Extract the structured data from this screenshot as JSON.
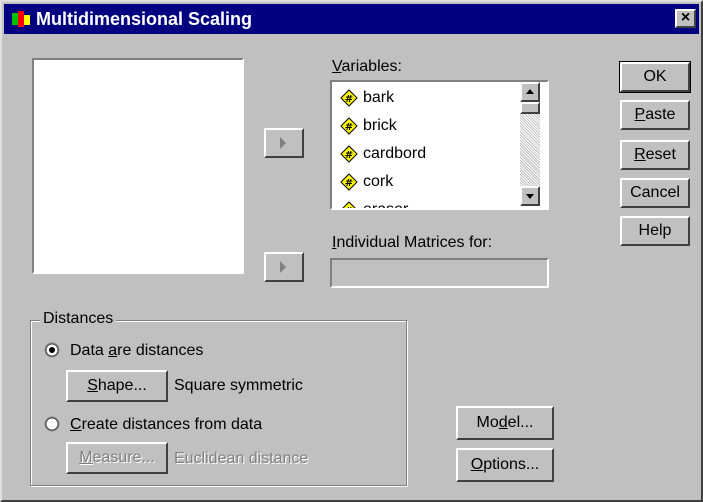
{
  "window": {
    "title": "Multidimensional Scaling",
    "close_label": "×"
  },
  "variables": {
    "label": "Variables:",
    "items": [
      {
        "name": "bark",
        "icon": "numeric-variable-icon"
      },
      {
        "name": "brick",
        "icon": "numeric-variable-icon"
      },
      {
        "name": "cardbord",
        "icon": "numeric-variable-icon"
      },
      {
        "name": "cork",
        "icon": "numeric-variable-icon"
      },
      {
        "name": "eraser",
        "icon": "numeric-variable-icon"
      }
    ]
  },
  "individual_matrices": {
    "label": "Individual Matrices for:",
    "value": ""
  },
  "distances": {
    "group_label": "Distances",
    "option_data_are": "Data are distances",
    "option_data_are_selected": true,
    "shape_button": "Shape...",
    "shape_value": "Square symmetric",
    "option_create": "Create distances from data",
    "option_create_selected": false,
    "measure_button": "Measure...",
    "measure_value": "Euclidean distance"
  },
  "buttons": {
    "ok": "OK",
    "paste": "Paste",
    "reset": "Reset",
    "cancel": "Cancel",
    "help": "Help",
    "model": "Model...",
    "options": "Options..."
  },
  "colors": {
    "title_bar": "#000080",
    "dialog_bg": "#c0c0c0",
    "icon_yellow": "#ffff00"
  }
}
